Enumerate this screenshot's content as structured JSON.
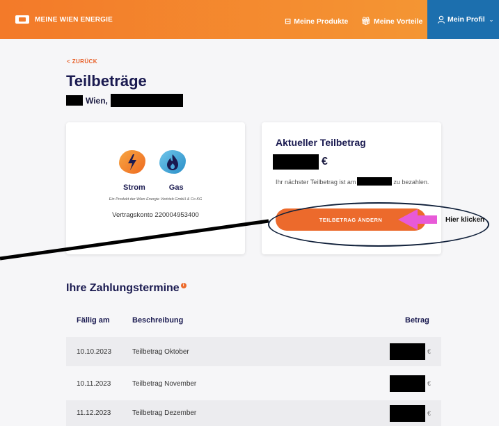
{
  "header": {
    "brand": "MEINE WIEN ENERGIE",
    "nav": [
      {
        "label": "Meine Produkte",
        "icon": "box-icon"
      },
      {
        "label": "Meine Vorteile",
        "icon": "gift-icon"
      }
    ],
    "profile": {
      "label": "Mein Profil",
      "icon": "user-icon"
    }
  },
  "page": {
    "back_link": "< ZURÜCK",
    "title": "Teilbeträge",
    "address_city": "Wien,"
  },
  "products_card": {
    "products": [
      {
        "label": "Strom",
        "icon": "lightning-icon"
      },
      {
        "label": "Gas",
        "icon": "flame-icon"
      }
    ],
    "subtitle": "Ein Produkt der Wien Energie Vertrieb GmbH & Co KG",
    "contract": "Vertragskonto 220004953400"
  },
  "amount_card": {
    "title": "Aktueller Teilbetrag",
    "currency": "€",
    "next_text_before": "Ihr nächster Teilbetrag ist am",
    "next_text_after": "zu bezahlen.",
    "button_label": "TEILBETRAG ÄNDERN"
  },
  "annotation": {
    "label": "Hier klicken"
  },
  "payments": {
    "title": "Ihre Zahlungstermine",
    "columns": {
      "date": "Fällig am",
      "description": "Beschreibung",
      "amount": "Betrag"
    },
    "rows": [
      {
        "date": "10.10.2023",
        "description": "Teilbetrag Oktober",
        "currency": "€"
      },
      {
        "date": "10.11.2023",
        "description": "Teilbetrag November",
        "currency": "€"
      },
      {
        "date": "11.12.2023",
        "description": "Teilbetrag Dezember",
        "currency": "€"
      }
    ]
  },
  "colors": {
    "header_orange": "#f37a29",
    "profile_blue": "#1c6fae",
    "button_orange": "#ec6a2c",
    "arrow_pink": "#e85ad8"
  }
}
